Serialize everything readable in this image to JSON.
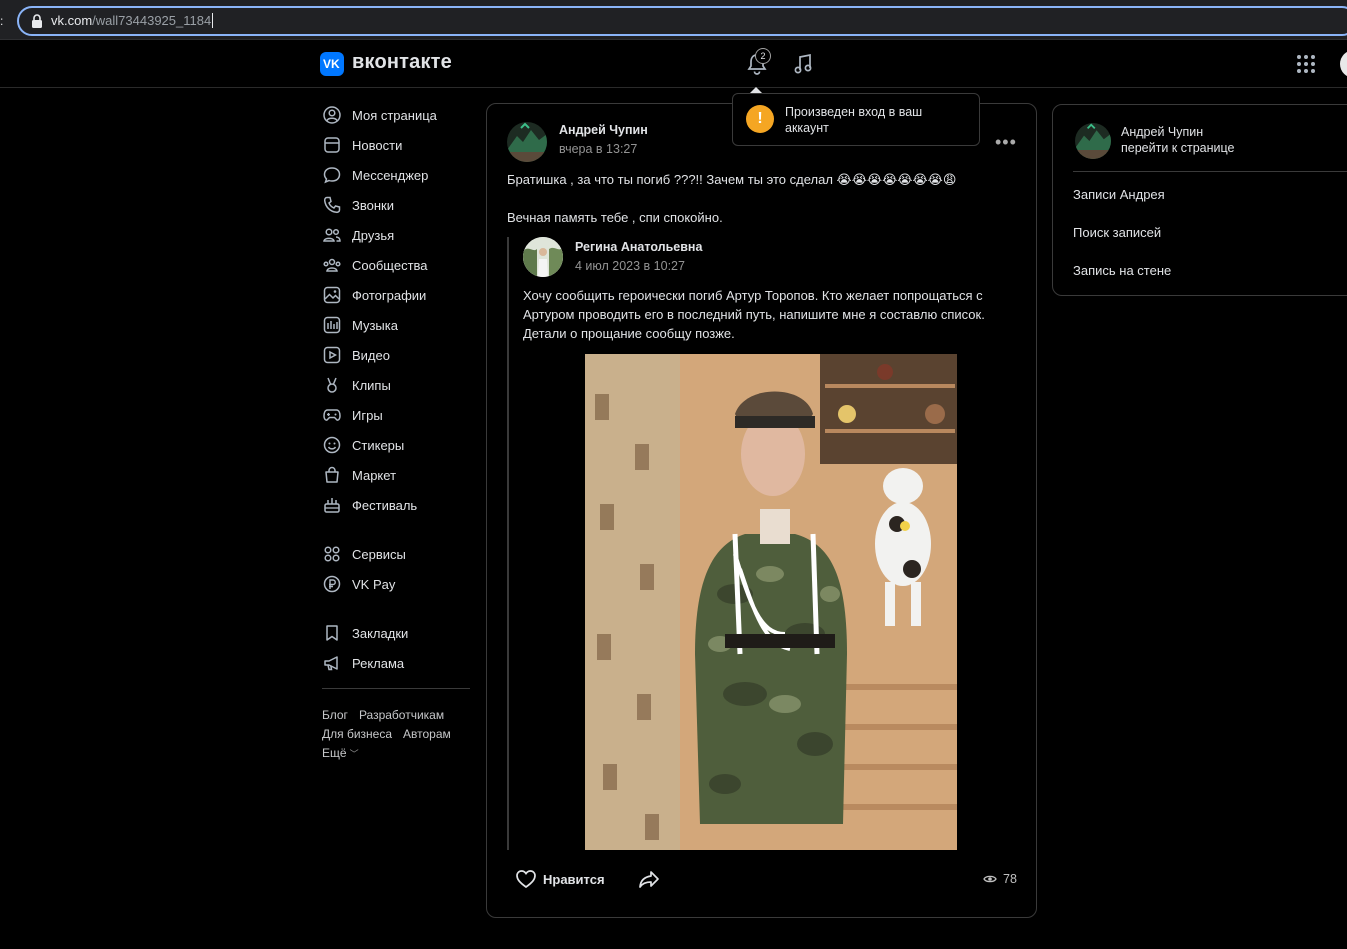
{
  "browser": {
    "url_host": "vk.com",
    "url_path": "/wall73443925_1184"
  },
  "header": {
    "brand": "вконтакте",
    "logo_text": "VK",
    "notifications_count": "2"
  },
  "sidebar": {
    "items": [
      {
        "label": "Моя страница",
        "icon": "user-circle-icon"
      },
      {
        "label": "Новости",
        "icon": "news-icon"
      },
      {
        "label": "Мессенджер",
        "icon": "message-icon"
      },
      {
        "label": "Звонки",
        "icon": "phone-icon"
      },
      {
        "label": "Друзья",
        "icon": "friends-icon"
      },
      {
        "label": "Сообщества",
        "icon": "communities-icon"
      },
      {
        "label": "Фотографии",
        "icon": "photo-icon"
      },
      {
        "label": "Музыка",
        "icon": "music-icon"
      },
      {
        "label": "Видео",
        "icon": "video-icon"
      },
      {
        "label": "Клипы",
        "icon": "clips-icon"
      },
      {
        "label": "Игры",
        "icon": "gamepad-icon"
      },
      {
        "label": "Стикеры",
        "icon": "smile-icon"
      },
      {
        "label": "Маркет",
        "icon": "bag-icon"
      },
      {
        "label": "Фестиваль",
        "icon": "festival-icon"
      }
    ],
    "items2": [
      {
        "label": "Сервисы",
        "icon": "services-icon"
      },
      {
        "label": "VK Pay",
        "icon": "ruble-icon"
      }
    ],
    "items3": [
      {
        "label": "Закладки",
        "icon": "bookmark-icon"
      },
      {
        "label": "Реклама",
        "icon": "megaphone-icon"
      }
    ],
    "footer": {
      "blog": "Блог",
      "developers": "Разработчикам",
      "business": "Для бизнеса",
      "authors": "Авторам",
      "more": "Ещё"
    }
  },
  "post": {
    "author": "Андрей Чупин",
    "date": "вчера в 13:27",
    "text_line1": "Братишка , за что ты погиб ???!! Зачем ты это сделал 😭😭😭😭😭😭😭😩",
    "text_line2": "Вечная память тебе , спи спокойно.",
    "repost": {
      "author": "Регина Анатольевна",
      "date": "4 июл 2023 в 10:27",
      "text": "Хочу сообщить героически погиб Артур Торопов. Кто желает попрощаться с Артуром проводить его в последний путь, напишите мне я составлю список. Детали о прощание сообщу позже."
    },
    "like_label": "Нравится",
    "views": "78"
  },
  "notification": {
    "text": "Произведен вход в ваш аккаунт"
  },
  "right_card": {
    "name": "Андрей Чупин",
    "link": "перейти к странице",
    "items": [
      "Записи Андрея",
      "Поиск записей",
      "Запись на стене"
    ]
  },
  "colors": {
    "accent": "#0077ff",
    "warning": "#f5a623",
    "background": "#000000",
    "text": "#e1e3e6"
  }
}
